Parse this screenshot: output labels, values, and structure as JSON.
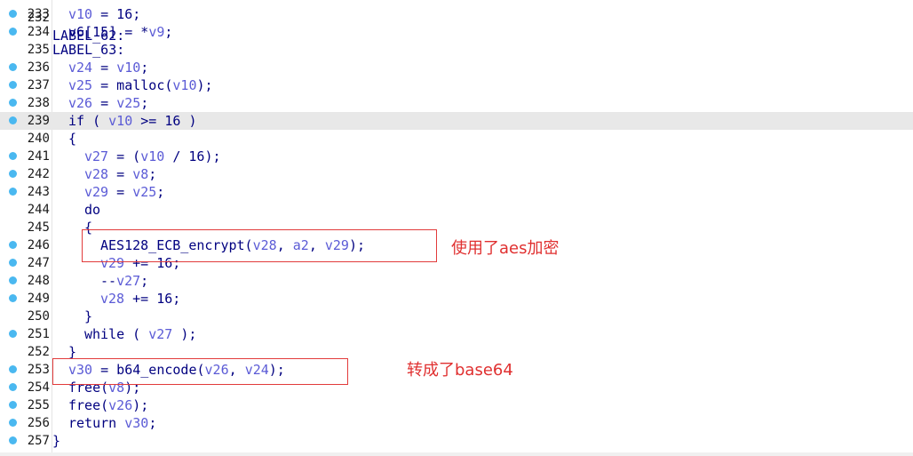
{
  "editor": {
    "first_partial_line": "LABEL_62:",
    "lines": [
      {
        "n": "233",
        "bp": true,
        "indent": 1,
        "tokens": [
          [
            "v",
            "v10"
          ],
          [
            "t",
            " = 16;"
          ]
        ]
      },
      {
        "n": "234",
        "bp": true,
        "indent": 1,
        "tokens": [
          [
            "t",
            "v6[15] = *"
          ],
          [
            "v",
            "v9"
          ],
          [
            "t",
            ";"
          ]
        ]
      },
      {
        "n": "235",
        "bp": false,
        "indent": 0,
        "tokens": [
          [
            "t",
            "LABEL_63:"
          ]
        ]
      },
      {
        "n": "236",
        "bp": true,
        "indent": 1,
        "tokens": [
          [
            "v",
            "v24"
          ],
          [
            "t",
            " = "
          ],
          [
            "v",
            "v10"
          ],
          [
            "t",
            ";"
          ]
        ]
      },
      {
        "n": "237",
        "bp": true,
        "indent": 1,
        "tokens": [
          [
            "v",
            "v25"
          ],
          [
            "t",
            " = malloc("
          ],
          [
            "v",
            "v10"
          ],
          [
            "t",
            ");"
          ]
        ]
      },
      {
        "n": "238",
        "bp": true,
        "indent": 1,
        "tokens": [
          [
            "v",
            "v26"
          ],
          [
            "t",
            " = "
          ],
          [
            "v",
            "v25"
          ],
          [
            "t",
            ";"
          ]
        ]
      },
      {
        "n": "239",
        "bp": true,
        "indent": 1,
        "highlight": true,
        "tokens": [
          [
            "t",
            "if ( "
          ],
          [
            "v",
            "v10"
          ],
          [
            "t",
            " >= 16 )"
          ]
        ]
      },
      {
        "n": "240",
        "bp": false,
        "indent": 1,
        "tokens": [
          [
            "t",
            "{"
          ]
        ]
      },
      {
        "n": "241",
        "bp": true,
        "indent": 2,
        "tokens": [
          [
            "v",
            "v27"
          ],
          [
            "t",
            " = ("
          ],
          [
            "v",
            "v10"
          ],
          [
            "t",
            " / 16);"
          ]
        ]
      },
      {
        "n": "242",
        "bp": true,
        "indent": 2,
        "tokens": [
          [
            "v",
            "v28"
          ],
          [
            "t",
            " = "
          ],
          [
            "v",
            "v8"
          ],
          [
            "t",
            ";"
          ]
        ]
      },
      {
        "n": "243",
        "bp": true,
        "indent": 2,
        "tokens": [
          [
            "v",
            "v29"
          ],
          [
            "t",
            " = "
          ],
          [
            "v",
            "v25"
          ],
          [
            "t",
            ";"
          ]
        ]
      },
      {
        "n": "244",
        "bp": false,
        "indent": 2,
        "tokens": [
          [
            "t",
            "do"
          ]
        ]
      },
      {
        "n": "245",
        "bp": false,
        "indent": 2,
        "tokens": [
          [
            "t",
            "{"
          ]
        ]
      },
      {
        "n": "246",
        "bp": true,
        "indent": 3,
        "tokens": [
          [
            "t",
            "AES128_ECB_encrypt("
          ],
          [
            "v",
            "v28"
          ],
          [
            "t",
            ", "
          ],
          [
            "v",
            "a2"
          ],
          [
            "t",
            ", "
          ],
          [
            "v",
            "v29"
          ],
          [
            "t",
            ");"
          ]
        ]
      },
      {
        "n": "247",
        "bp": true,
        "indent": 3,
        "tokens": [
          [
            "v",
            "v29"
          ],
          [
            "t",
            " += 16;"
          ]
        ]
      },
      {
        "n": "248",
        "bp": true,
        "indent": 3,
        "tokens": [
          [
            "t",
            "--"
          ],
          [
            "v",
            "v27"
          ],
          [
            "t",
            ";"
          ]
        ]
      },
      {
        "n": "249",
        "bp": true,
        "indent": 3,
        "tokens": [
          [
            "v",
            "v28"
          ],
          [
            "t",
            " += 16;"
          ]
        ]
      },
      {
        "n": "250",
        "bp": false,
        "indent": 2,
        "tokens": [
          [
            "t",
            "}"
          ]
        ]
      },
      {
        "n": "251",
        "bp": true,
        "indent": 2,
        "tokens": [
          [
            "t",
            "while ( "
          ],
          [
            "v",
            "v27"
          ],
          [
            "t",
            " );"
          ]
        ]
      },
      {
        "n": "252",
        "bp": false,
        "indent": 1,
        "tokens": [
          [
            "t",
            "}"
          ]
        ]
      },
      {
        "n": "253",
        "bp": true,
        "indent": 1,
        "tokens": [
          [
            "v",
            "v30"
          ],
          [
            "t",
            " = b64_encode("
          ],
          [
            "v",
            "v26"
          ],
          [
            "t",
            ", "
          ],
          [
            "v",
            "v24"
          ],
          [
            "t",
            ");"
          ]
        ]
      },
      {
        "n": "254",
        "bp": true,
        "indent": 1,
        "tokens": [
          [
            "t",
            "free("
          ],
          [
            "v",
            "v8"
          ],
          [
            "t",
            ");"
          ]
        ]
      },
      {
        "n": "255",
        "bp": true,
        "indent": 1,
        "tokens": [
          [
            "t",
            "free("
          ],
          [
            "v",
            "v26"
          ],
          [
            "t",
            ");"
          ]
        ]
      },
      {
        "n": "256",
        "bp": true,
        "indent": 1,
        "tokens": [
          [
            "t",
            "return "
          ],
          [
            "v",
            "v30"
          ],
          [
            "t",
            ";"
          ]
        ]
      },
      {
        "n": "257",
        "bp": true,
        "indent": 0,
        "tokens": [
          [
            "t",
            "}"
          ]
        ]
      }
    ]
  },
  "annotations": {
    "aes": "使用了aes加密",
    "base64": "转成了base64"
  },
  "colors": {
    "code_text": "#000080",
    "variable": "#5b5bd6",
    "breakpoint": "#4ab8f0",
    "annotation": "#e03030",
    "highlight_row": "#e8e8e8"
  }
}
